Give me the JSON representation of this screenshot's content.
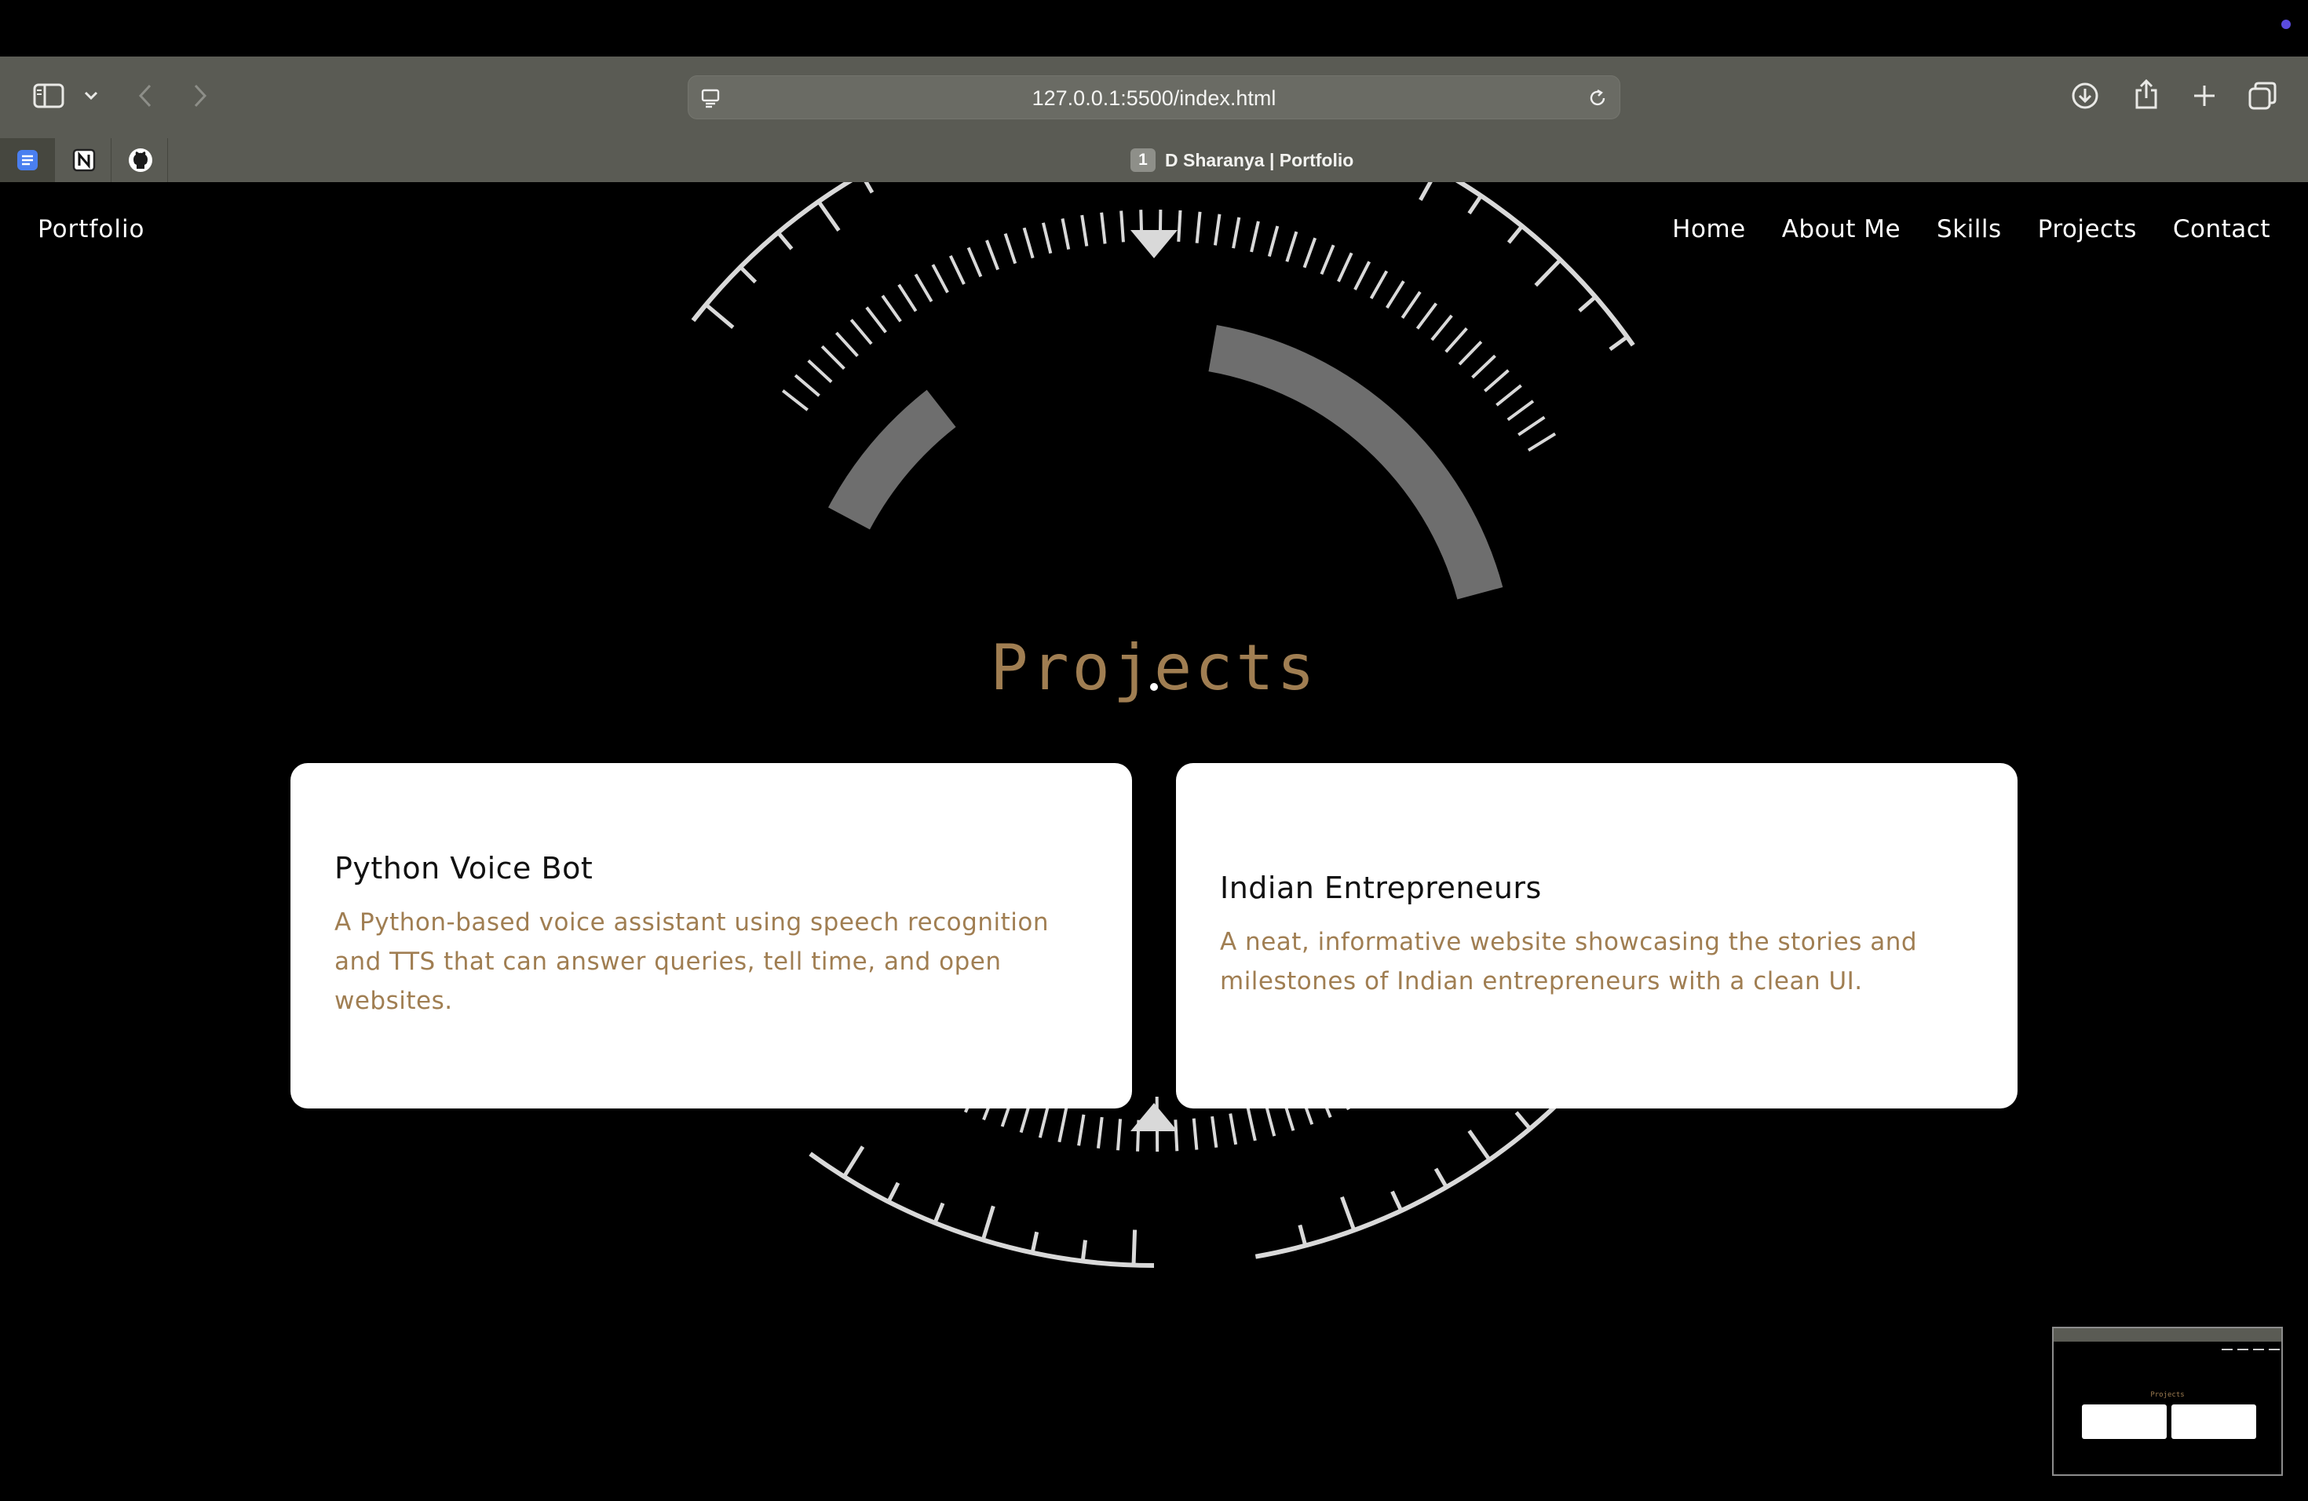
{
  "browser": {
    "url": "127.0.0.1:5500/index.html",
    "tab_number": "1",
    "tab_title": "D Sharanya | Portfolio",
    "icons": [
      "sidebar-icon",
      "chevron-down-icon",
      "back-icon",
      "forward-icon",
      "site-settings-icon",
      "reload-icon",
      "download-icon",
      "share-icon",
      "new-tab-icon",
      "tab-overview-icon"
    ],
    "pinned_tabs": [
      "docs-icon",
      "notion-icon",
      "github-icon"
    ]
  },
  "nav": {
    "logo": "Portfolio",
    "links": [
      "Home",
      "About Me",
      "Skills",
      "Projects",
      "Contact"
    ]
  },
  "projects": {
    "title": "Projects",
    "cards": [
      {
        "title": "Python Voice Bot",
        "description": "A Python-based voice assistant using speech recognition and TTS that can answer queries, tell time, and open websites."
      },
      {
        "title": "Indian Entrepreneurs",
        "description": "A neat, informative website showcasing the stories and milestones of Indian entrepreneurs with a clean UI."
      }
    ]
  },
  "colors": {
    "accent": "#a07e52",
    "page_bg": "#000000",
    "card_bg": "#ffffff",
    "chrome_bg": "#5a5b54",
    "status_dot": "#5b4be0"
  }
}
